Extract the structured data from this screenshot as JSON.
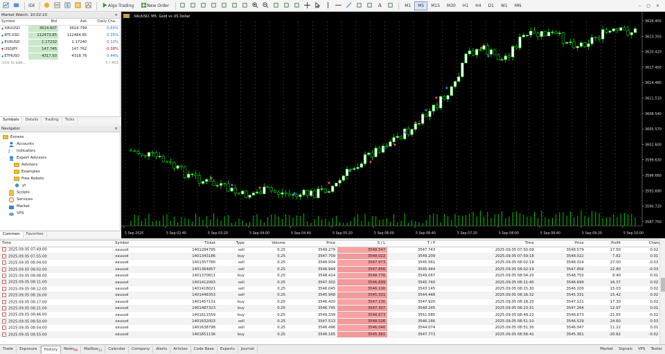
{
  "toolbar": {
    "items": [
      "new-chart",
      "profiles",
      "sep",
      "ide",
      "sep",
      "symbols",
      "market-watch",
      "navigator",
      "data-window",
      "strategy-tester",
      "sep"
    ],
    "algo_label": "Algo Trading",
    "order_label": "New Order",
    "timeframes": [
      "M1",
      "M5",
      "M15",
      "M30",
      "H1",
      "H4",
      "D1",
      "W1",
      "MN"
    ],
    "active_timeframe": "M5"
  },
  "market_watch": {
    "title": "Market Watch: 10:02:10",
    "columns": [
      "Symbol",
      "Bid",
      "Ask",
      "Daily Cha..."
    ],
    "rows": [
      {
        "symbol": "XAUUSD",
        "bid": "3614.607",
        "ask": "3614.799",
        "change": "0.65%",
        "dir": "pos"
      },
      {
        "symbol": "BTCUSD",
        "bid": "112473.85",
        "ask": "112484.85",
        "change": "0.35%",
        "dir": "pos"
      },
      {
        "symbol": "EURUSD",
        "bid": "1.17232",
        "ask": "1.17240",
        "change": "0.12%",
        "dir": "pos"
      },
      {
        "symbol": "USDJPY",
        "bid": "147.745",
        "ask": "147.762",
        "change": "-0.38%",
        "dir": "neg"
      },
      {
        "symbol": "ETHUSD",
        "bid": "4317.50",
        "ask": "4318.76",
        "change": "0.44%",
        "dir": "pos"
      }
    ],
    "add_label": "click to add...",
    "count": "5 / 403",
    "tabs": [
      "Symbols",
      "Details",
      "Trading",
      "Ticks"
    ]
  },
  "navigator": {
    "title": "Navigator",
    "items": [
      {
        "label": "Exness",
        "level": 0,
        "icon": "folder"
      },
      {
        "label": "Accounts",
        "level": 1,
        "icon": "accounts"
      },
      {
        "label": "Indicators",
        "level": 1,
        "icon": "indicators"
      },
      {
        "label": "Expert Advisors",
        "level": 1,
        "icon": "experts"
      },
      {
        "label": "Advisors",
        "level": 2,
        "icon": "folder"
      },
      {
        "label": "Examples",
        "level": 2,
        "icon": "folder"
      },
      {
        "label": "Free Robots",
        "level": 2,
        "icon": "folder"
      },
      {
        "label": "yt",
        "level": 2,
        "icon": "expert"
      },
      {
        "label": "Scripts",
        "level": 1,
        "icon": "scripts"
      },
      {
        "label": "Services",
        "level": 1,
        "icon": "services"
      },
      {
        "label": "Market",
        "level": 1,
        "icon": "market"
      },
      {
        "label": "VPS",
        "level": 1,
        "icon": "vps"
      }
    ],
    "tabs": [
      "Common",
      "Favorites"
    ]
  },
  "chart": {
    "title": "XAUUSD, M5:  Gold vs US Dollar",
    "price_labels": [
      "3626.450",
      "3623.350",
      "3620.420",
      "3617.450",
      "3614.480",
      "3611.510",
      "3608.540",
      "3605.570",
      "3602.600",
      "3599.630",
      "3596.660",
      "3593.690",
      "3590.720",
      "3587.750"
    ],
    "time_labels": [
      "5 Sep 2025",
      "5 Sep 02:40",
      "5 Sep 03:20",
      "5 Sep 04:00",
      "5 Sep 04:40",
      "5 Sep 05:20",
      "5 Sep 06:00",
      "5 Sep 06:40",
      "5 Sep 07:20",
      "5 Sep 08:00",
      "5 Sep 08:40",
      "5 Sep 09:20",
      "5 Sep 10:00"
    ],
    "colors": {
      "bull": "#ffffff",
      "bear": "#000000",
      "wick": "#00ff00",
      "grid": "#5a5a5a",
      "volume": "#00c800"
    }
  },
  "history": {
    "columns": [
      "Time",
      "Symbol",
      "Ticket",
      "Type",
      "Volume",
      "Price",
      "S / L",
      "T / P",
      "Time",
      "Price",
      "Profit",
      "Change"
    ],
    "rows": [
      [
        "2025.09.05 07:49:00",
        "xauusd",
        "1401284795",
        "sell",
        "0.25",
        "3549.279",
        "3548.547",
        "3547.743",
        "2025.09.05 07:50:09",
        "3548.579",
        "17.50",
        "0.02 %"
      ],
      [
        "2025.09.05 07:55:00",
        "xauusd",
        "1401343186",
        "buy",
        "0.25",
        "3547.709",
        "3548.022",
        "3549.209",
        "2025.09.05 07:59:18",
        "3548.022",
        "7.82",
        "0.01 %"
      ],
      [
        "2025.09.05 08:04:00",
        "xauusd",
        "1401357780",
        "sell",
        "0.25",
        "3546.934",
        "3547.973",
        "3545.561",
        "2025.09.05 08:02:19",
        "3548.014",
        "27.00",
        "-0.03 %"
      ],
      [
        "2025.09.05 08:02:00",
        "xauusd",
        "1401364857",
        "sell",
        "0.25",
        "3546.944",
        "3547.856",
        "3545.444",
        "2025.09.05 08:02:19",
        "3547.856",
        "22.80",
        "-0.03 %"
      ],
      [
        "2025.09.05 08:08:00",
        "xauusd",
        "1401370811",
        "buy",
        "0.25",
        "3548.414",
        "3548.776",
        "3549.087",
        "2025.09.05 08:04:20",
        "3548.750",
        "8.40",
        "0.01 %"
      ],
      [
        "2025.09.05 08:11:00",
        "xauusd",
        "1401412063",
        "sell",
        "0.25",
        "3547.302",
        "3546.699",
        "3545.740",
        "2025.09.05 08:11:40",
        "3546.699",
        "16.37",
        "0.02 %"
      ],
      [
        "2025.09.05 08:12:00",
        "xauusd",
        "1401418021",
        "sell",
        "0.25",
        "3546.045",
        "3546.100",
        "3543.145",
        "2025.09.05 08:15:30",
        "3546.100",
        "15.03",
        "0.02 %"
      ],
      [
        "2025.09.05 08:16:00",
        "xauusd",
        "1401448353",
        "sell",
        "0.25",
        "3545.948",
        "3545.331",
        "3544.448",
        "2025.09.05 08:16:32",
        "3545.331",
        "15.42",
        "0.02 %"
      ],
      [
        "2025.09.05 08:17:00",
        "xauusd",
        "1401457131",
        "buy",
        "0.25",
        "3546.420",
        "3547.130",
        "3547.920",
        "2025.09.05 08:18:20",
        "3547.121",
        "17.30",
        "0.02 %"
      ],
      [
        "2025.09.05 08:21:00",
        "xauusd",
        "1401487323",
        "buy",
        "0.25",
        "3546.745",
        "3547.307",
        "3548.245",
        "2025.09.05 08:23:31",
        "3547.264",
        "12.97",
        "0.01 %"
      ],
      [
        "2025.09.05 08:46:00",
        "xauusd",
        "1401611559",
        "buy",
        "0.25",
        "3549.339",
        "3548.673",
        "3551.085",
        "2025.09.05 08:48:22",
        "3548.673",
        "-21.65",
        "-0.02 %"
      ],
      [
        "2025.09.05 08:50:00",
        "xauusd",
        "1401632003",
        "sell",
        "0.25",
        "3547.513",
        "3548.526",
        "3546.166",
        "2025.09.05 08:51:10",
        "3546.529",
        "24.60",
        "0.03 %"
      ],
      [
        "2025.09.05 08:54:00",
        "xauusd",
        "1401638798",
        "sell",
        "0.25",
        "3546.496",
        "3546.046",
        "3544.074",
        "2025.09.05 08:51:30",
        "3546.047",
        "11.22",
        "0.01 %"
      ],
      [
        "2025.09.05 08:55:00",
        "xauusd",
        "1401651136",
        "buy",
        "0.25",
        "3546.165",
        "3545.361",
        "3547.773",
        "2025.09.05 08:56:41",
        "3545.361",
        "-20.62",
        "-0.02 %"
      ]
    ]
  },
  "bottom_tabs": [
    {
      "label": "Trade"
    },
    {
      "label": "Exposure"
    },
    {
      "label": "History",
      "active": true
    },
    {
      "label": "News",
      "badge": "99"
    },
    {
      "label": "Mailbox",
      "badge": "11"
    },
    {
      "label": "Calendar"
    },
    {
      "label": "Company"
    },
    {
      "label": "Alerts"
    },
    {
      "label": "Articles"
    },
    {
      "label": "Code Base"
    },
    {
      "label": "Experts"
    },
    {
      "label": "Journal"
    }
  ],
  "bottom_right": [
    "Market",
    "Signals",
    "VPS",
    "Tester"
  ]
}
